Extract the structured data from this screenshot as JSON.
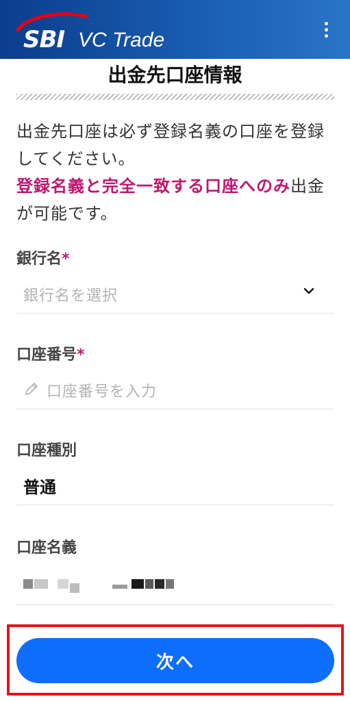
{
  "header": {
    "logo_sbi": "SBI",
    "logo_vc": "VC Trade",
    "menu_icon": "vertical-ellipsis-icon",
    "brand_color": "#0b3d8c"
  },
  "page": {
    "title": "出金先口座情報"
  },
  "notice": {
    "line1": "出金先口座は必ず登録名義の口座を登録してください。",
    "highlight": "登録名義と完全一致する口座へのみ",
    "line2": "出金が可能です。",
    "highlight_color": "#c0166f"
  },
  "form": {
    "bank": {
      "label": "銀行名",
      "required": "*",
      "placeholder": "銀行名を選択",
      "icon": "chevron-down-icon"
    },
    "account_number": {
      "label": "口座番号",
      "required": "*",
      "placeholder": "口座番号を入力",
      "icon": "pencil-icon"
    },
    "account_type": {
      "label": "口座種別",
      "value": "普通"
    },
    "account_holder": {
      "label": "口座名義"
    }
  },
  "actions": {
    "next_label": "次へ",
    "button_color": "#0d6efd",
    "highlight_border_color": "#e5141b"
  }
}
